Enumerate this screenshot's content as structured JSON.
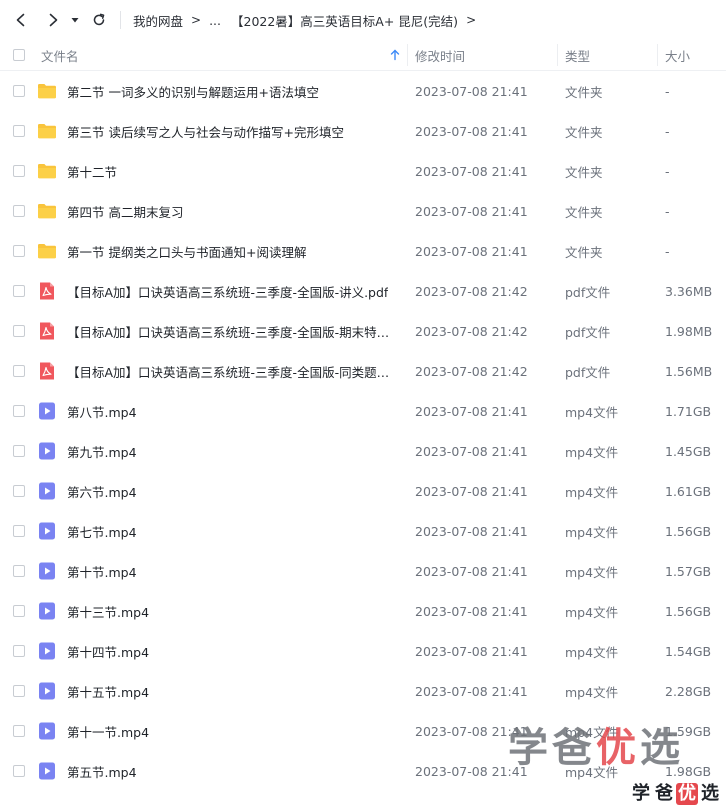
{
  "toolbar": {
    "breadcrumb": [
      "我的网盘",
      "...",
      "【2022暑】高三英语目标A+ 昆尼(完结)"
    ]
  },
  "header": {
    "name": "文件名",
    "modified": "修改时间",
    "type": "类型",
    "size": "大小"
  },
  "files": [
    {
      "icon": "folder-icon",
      "name": "第二节 一词多义的识别与解题运用+语法填空",
      "modified": "2023-07-08 21:41",
      "type": "文件夹",
      "size": "-"
    },
    {
      "icon": "folder-icon",
      "name": "第三节 读后续写之人与社会与动作描写+完形填空",
      "modified": "2023-07-08 21:41",
      "type": "文件夹",
      "size": "-"
    },
    {
      "icon": "folder-icon",
      "name": "第十二节",
      "modified": "2023-07-08 21:41",
      "type": "文件夹",
      "size": "-"
    },
    {
      "icon": "folder-icon",
      "name": "第四节 高二期末复习",
      "modified": "2023-07-08 21:41",
      "type": "文件夹",
      "size": "-"
    },
    {
      "icon": "folder-icon",
      "name": "第一节 提纲类之口头与书面通知+阅读理解",
      "modified": "2023-07-08 21:41",
      "type": "文件夹",
      "size": "-"
    },
    {
      "icon": "pdf-icon",
      "name": "【目标A加】口诀英语高三系统班-三季度-全国版-讲义.pdf",
      "modified": "2023-07-08 21:42",
      "type": "pdf文件",
      "size": "3.36MB"
    },
    {
      "icon": "pdf-icon",
      "name": "【目标A加】口诀英语高三系统班-三季度-全国版-期末特辑....",
      "modified": "2023-07-08 21:42",
      "type": "pdf文件",
      "size": "1.98MB"
    },
    {
      "icon": "pdf-icon",
      "name": "【目标A加】口诀英语高三系统班-三季度-全国版-同类题手...",
      "modified": "2023-07-08 21:42",
      "type": "pdf文件",
      "size": "1.56MB"
    },
    {
      "icon": "video-icon",
      "name": "第八节.mp4",
      "modified": "2023-07-08 21:41",
      "type": "mp4文件",
      "size": "1.71GB"
    },
    {
      "icon": "video-icon",
      "name": "第九节.mp4",
      "modified": "2023-07-08 21:41",
      "type": "mp4文件",
      "size": "1.45GB"
    },
    {
      "icon": "video-icon",
      "name": "第六节.mp4",
      "modified": "2023-07-08 21:41",
      "type": "mp4文件",
      "size": "1.61GB"
    },
    {
      "icon": "video-icon",
      "name": "第七节.mp4",
      "modified": "2023-07-08 21:41",
      "type": "mp4文件",
      "size": "1.56GB"
    },
    {
      "icon": "video-icon",
      "name": "第十节.mp4",
      "modified": "2023-07-08 21:41",
      "type": "mp4文件",
      "size": "1.57GB"
    },
    {
      "icon": "video-icon",
      "name": "第十三节.mp4",
      "modified": "2023-07-08 21:41",
      "type": "mp4文件",
      "size": "1.56GB"
    },
    {
      "icon": "video-icon",
      "name": "第十四节.mp4",
      "modified": "2023-07-08 21:41",
      "type": "mp4文件",
      "size": "1.54GB"
    },
    {
      "icon": "video-icon",
      "name": "第十五节.mp4",
      "modified": "2023-07-08 21:41",
      "type": "mp4文件",
      "size": "2.28GB"
    },
    {
      "icon": "video-icon",
      "name": "第十一节.mp4",
      "modified": "2023-07-08 21:41",
      "type": "mp4文件",
      "size": "1.59GB"
    },
    {
      "icon": "video-icon",
      "name": "第五节.mp4",
      "modified": "2023-07-08 21:41",
      "type": "mp4文件",
      "size": "1.98GB"
    }
  ],
  "watermark": {
    "chars": [
      "学",
      "爸",
      "优",
      "选"
    ]
  },
  "colors": {
    "folder": "#f9c43c",
    "pdf": "#f0575d",
    "video": "#7a83f2",
    "sort_arrow": "#3d8af7",
    "watermark_gray": "#6f7378",
    "watermark_red": "#e5484d"
  }
}
